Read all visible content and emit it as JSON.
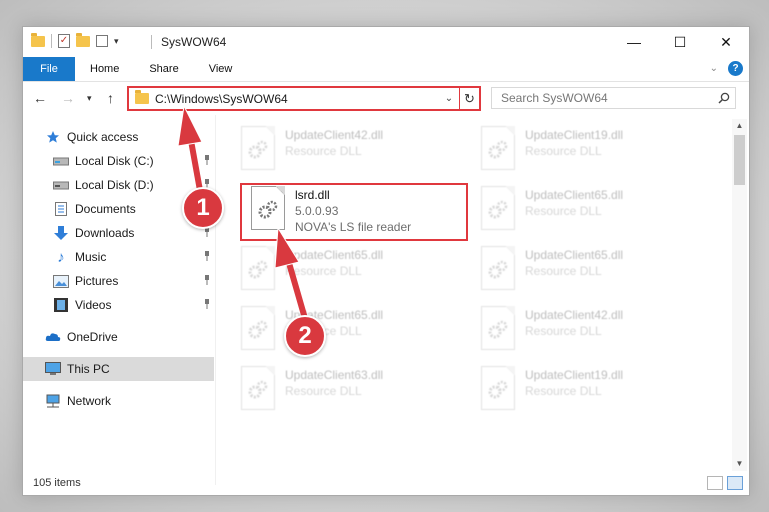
{
  "window": {
    "title": "SysWOW64",
    "controls": {
      "minimize": "—",
      "maximize": "☐",
      "close": "✕"
    }
  },
  "ribbon": {
    "tabs": [
      "File",
      "Home",
      "Share",
      "View"
    ],
    "help": "?"
  },
  "nav": {
    "address": "C:\\Windows\\SysWOW64",
    "search_placeholder": "Search SysWOW64"
  },
  "sidebar": {
    "items": [
      {
        "label": "Quick access",
        "icon": "star-icon"
      },
      {
        "label": "Local Disk (C:)",
        "icon": "drive-icon",
        "pinned": true
      },
      {
        "label": "Local Disk (D:)",
        "icon": "drive-icon",
        "pinned": true
      },
      {
        "label": "Documents",
        "icon": "documents-icon",
        "pinned": true
      },
      {
        "label": "Downloads",
        "icon": "download-icon",
        "pinned": true
      },
      {
        "label": "Music",
        "icon": "music-icon",
        "pinned": true
      },
      {
        "label": "Pictures",
        "icon": "pictures-icon",
        "pinned": true
      },
      {
        "label": "Videos",
        "icon": "video-icon",
        "pinned": true
      },
      {
        "label": "OneDrive",
        "icon": "cloud-icon"
      },
      {
        "label": "This PC",
        "icon": "computer-icon",
        "selected": true
      },
      {
        "label": "Network",
        "icon": "network-icon"
      }
    ]
  },
  "files": {
    "highlighted": {
      "name": "lsrd.dll",
      "version": "5.0.0.93",
      "description": "NOVA's LS file reader"
    },
    "left_column": [
      {
        "name": "UpdateClient42.dll",
        "type": "Resource DLL"
      },
      {
        "name": "UpdateClient65.dll",
        "type": "Resource DLL"
      },
      {
        "name": "UpdateClient65.dll",
        "type": "Resource DLL"
      },
      {
        "name": "UpdateClient63.dll",
        "type": "Resource DLL"
      }
    ],
    "right_column": [
      {
        "name": "UpdateClient19.dll",
        "type": "Resource DLL"
      },
      {
        "name": "UpdateClient65.dll",
        "type": "Resource DLL"
      },
      {
        "name": "UpdateClient65.dll",
        "type": "Resource DLL"
      },
      {
        "name": "UpdateClient42.dll",
        "type": "Resource DLL"
      },
      {
        "name": "UpdateClient19.dll",
        "type": "Resource DLL"
      }
    ]
  },
  "status": {
    "item_count": "105 items"
  },
  "annotations": {
    "step1": "1",
    "step2": "2"
  },
  "colors": {
    "accent": "#1979ca",
    "highlight": "#e0383e",
    "badge": "#d9393f"
  }
}
